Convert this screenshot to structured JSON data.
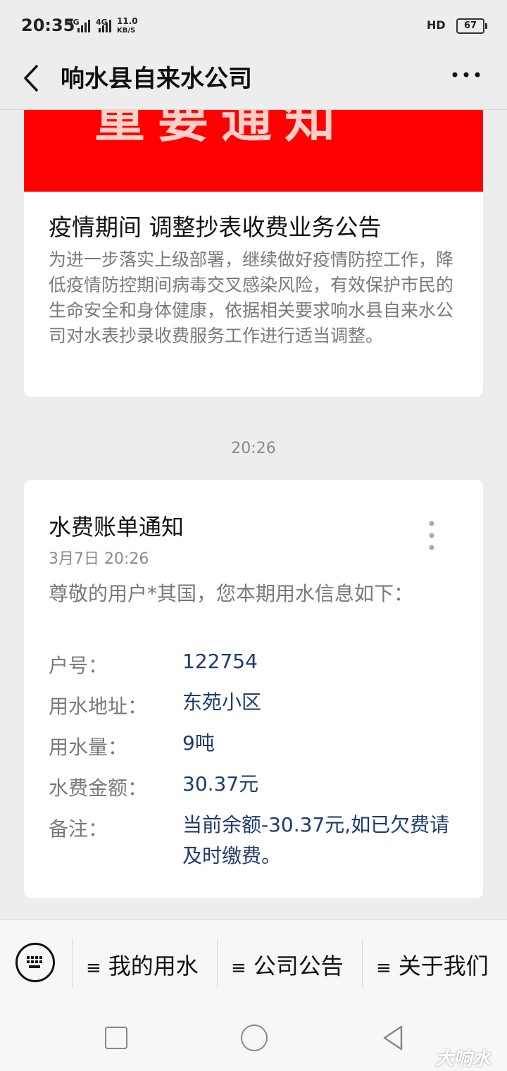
{
  "status_bar": {
    "time": "20:35",
    "net1": "4G",
    "net2": "4G",
    "speed_value": "11.0",
    "speed_unit": "KB/S",
    "hd": "HD",
    "battery": "67"
  },
  "header": {
    "title": "响水县自来水公司"
  },
  "article": {
    "banner_text": "重要通知",
    "title": "疫情期间 调整抄表收费业务公告",
    "summary": "为进一步落实上级部署，继续做好疫情防控工作，降低疫情防控期间病毒交叉感染风险，有效保护市民的生命安全和身体健康，依据相关要求响水县自来水公司对水表抄录收费服务工作进行适当调整。"
  },
  "time_separator": "20:26",
  "bill": {
    "title": "水费账单通知",
    "date": "3月7日  20:26",
    "greeting": "尊敬的用户*其国，您本期用水信息如下：",
    "rows": [
      {
        "label": "户号：",
        "value": "122754"
      },
      {
        "label": "用水地址：",
        "value": "东苑小区"
      },
      {
        "label": "用水量：",
        "value": "9吨"
      },
      {
        "label": "水费金额：",
        "value": "30.37元"
      },
      {
        "label": "备注：",
        "value": "当前余额-30.37元,如已欠费请及时缴费。"
      }
    ]
  },
  "menu": {
    "items": [
      {
        "label": "我的用水"
      },
      {
        "label": "公司公告"
      },
      {
        "label": "关于我们"
      }
    ]
  },
  "watermark": "大响水"
}
